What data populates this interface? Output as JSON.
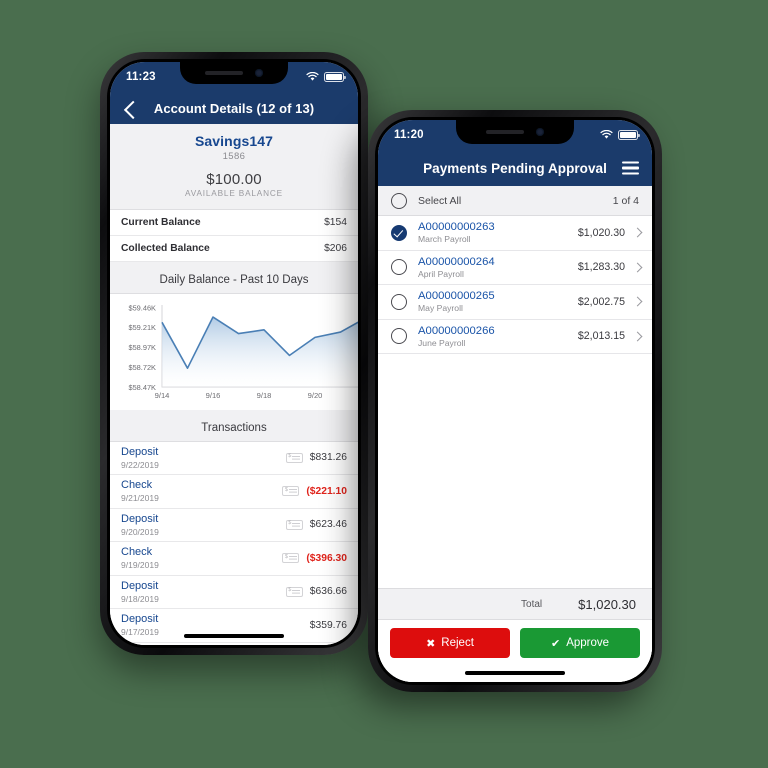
{
  "canvas": {
    "background": "#4a6e4e"
  },
  "theme": {
    "navy": "#1b3b6b",
    "link_blue": "#17478f",
    "red": "#dd0d0d",
    "green": "#1a9934",
    "negative": "#e0241c"
  },
  "phone_left": {
    "status": {
      "time": "11:23",
      "wifi_icon": "wifi-icon",
      "battery_icon": "battery-icon"
    },
    "nav": {
      "back_icon": "back-chevron-icon",
      "title": "Account Details (12 of 13)"
    },
    "account": {
      "name": "Savings147",
      "number": "1586",
      "balance": "$100.00",
      "balance_label": "AVAILABLE BALANCE",
      "rows": [
        {
          "label": "Current Balance",
          "value": "$154"
        },
        {
          "label": "Collected Balance",
          "value": "$206"
        }
      ]
    },
    "chart_card": {
      "title": "Daily Balance - Past 10 Days"
    },
    "transactions": {
      "header": "Transactions",
      "items": [
        {
          "type": "Deposit",
          "date": "9/22/2019",
          "amount": "$831.26",
          "negative": false,
          "icon": "check-image-icon"
        },
        {
          "type": "Check",
          "date": "9/21/2019",
          "amount": "($221.10",
          "negative": true,
          "icon": "check-image-icon"
        },
        {
          "type": "Deposit",
          "date": "9/20/2019",
          "amount": "$623.46",
          "negative": false,
          "icon": "check-image-icon"
        },
        {
          "type": "Check",
          "date": "9/19/2019",
          "amount": "($396.30",
          "negative": true,
          "icon": "check-image-icon"
        },
        {
          "type": "Deposit",
          "date": "9/18/2019",
          "amount": "$636.66",
          "negative": false,
          "icon": "check-image-icon"
        },
        {
          "type": "Deposit",
          "date": "9/17/2019",
          "amount": "$359.76",
          "negative": false,
          "icon": ""
        }
      ]
    }
  },
  "phone_right": {
    "status": {
      "time": "11:20",
      "wifi_icon": "wifi-icon",
      "battery_icon": "battery-icon"
    },
    "nav": {
      "title": "Payments Pending Approval",
      "menu_icon": "hamburger-icon"
    },
    "select_all": {
      "label": "Select All",
      "count": "1 of 4",
      "checked": false
    },
    "payments": [
      {
        "id": "A00000000263",
        "sub": "March Payroll",
        "amount": "$1,020.30",
        "checked": true
      },
      {
        "id": "A00000000264",
        "sub": "April Payroll",
        "amount": "$1,283.30",
        "checked": false
      },
      {
        "id": "A00000000265",
        "sub": "May Payroll",
        "amount": "$2,002.75",
        "checked": false
      },
      {
        "id": "A00000000266",
        "sub": "June Payroll",
        "amount": "$2,013.15",
        "checked": false
      }
    ],
    "total": {
      "label": "Total",
      "value": "$1,020.30"
    },
    "buttons": {
      "reject": "Reject",
      "approve": "Approve",
      "reject_glyph": "✖",
      "approve_glyph": "✔"
    }
  },
  "chart_data": {
    "type": "area",
    "title": "Daily Balance - Past 10 Days",
    "xlabel": "",
    "ylabel": "",
    "x": [
      "9/14",
      "9/15",
      "9/16",
      "9/17",
      "9/18",
      "9/19",
      "9/20",
      "9/21",
      "9/22"
    ],
    "tick_labels_x": [
      "9/14",
      "9/16",
      "9/18",
      "9/20"
    ],
    "tick_labels_y": [
      "$58.47K",
      "$58.72K",
      "$58.97K",
      "$59.21K",
      "$59.46K"
    ],
    "values": [
      59330,
      58720,
      59400,
      59180,
      59230,
      58890,
      59130,
      59200,
      59390
    ],
    "ylim": [
      58470,
      59560
    ],
    "grid": false,
    "legend": "none",
    "line_color": "#4a7fb5",
    "fill_gradient": [
      "#adc8e3",
      "#ffffff"
    ]
  }
}
